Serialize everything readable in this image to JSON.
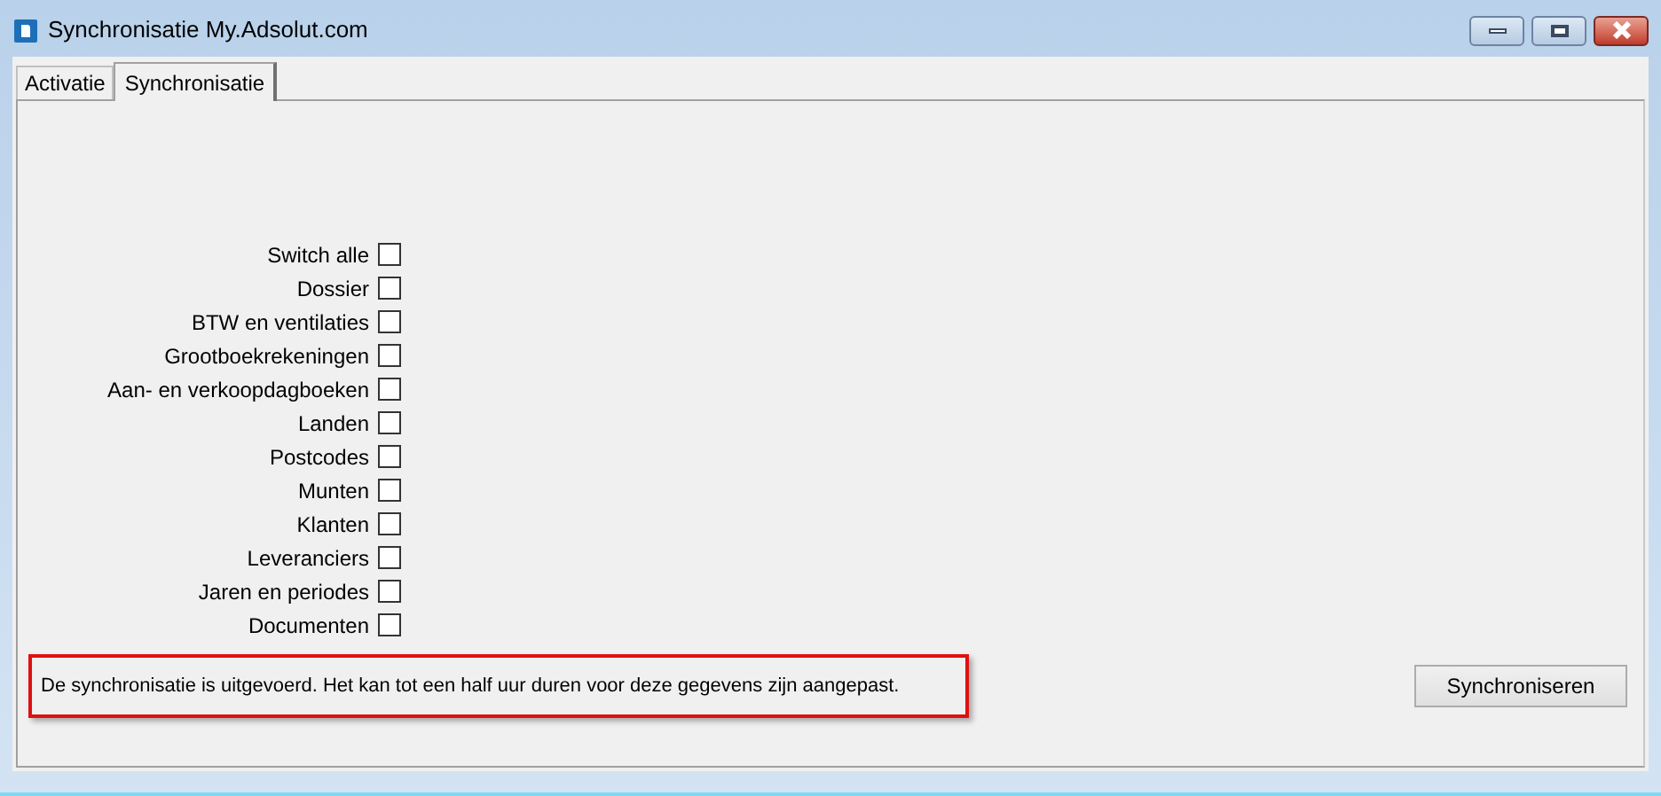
{
  "window": {
    "title": "Synchronisatie My.Adsolut.com"
  },
  "tabs": [
    {
      "label": "Activatie",
      "selected": false
    },
    {
      "label": "Synchronisatie",
      "selected": true
    }
  ],
  "options": [
    {
      "label": "Switch alle",
      "checked": false
    },
    {
      "label": "Dossier",
      "checked": false
    },
    {
      "label": "BTW en ventilaties",
      "checked": false
    },
    {
      "label": "Grootboekrekeningen",
      "checked": false
    },
    {
      "label": "Aan- en verkoopdagboeken",
      "checked": false
    },
    {
      "label": "Landen",
      "checked": false
    },
    {
      "label": "Postcodes",
      "checked": false
    },
    {
      "label": "Munten",
      "checked": false
    },
    {
      "label": "Klanten",
      "checked": false
    },
    {
      "label": "Leveranciers",
      "checked": false
    },
    {
      "label": "Jaren en periodes",
      "checked": false
    },
    {
      "label": "Documenten",
      "checked": false
    }
  ],
  "message": "De synchronisatie is uitgevoerd. Het kan tot een half uur duren voor deze gegevens zijn aangepast.",
  "buttons": [
    "Synchroniseren"
  ]
}
